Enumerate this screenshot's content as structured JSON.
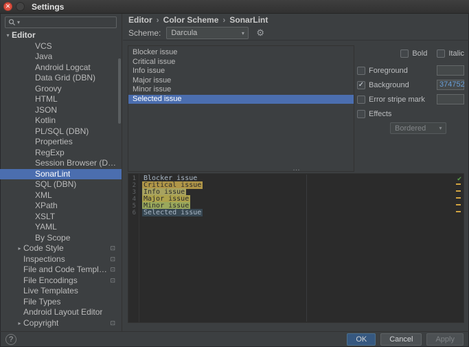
{
  "window": {
    "title": "Settings",
    "help_label": "?"
  },
  "icons": {
    "close": "✕",
    "check": "✓",
    "chevron_down": "▾",
    "tree_expanded": "▾",
    "tree_collapsed": "▸",
    "gear": "⚙",
    "status_ok": "✔",
    "project_badge": "⊡",
    "splitter_dots": "…"
  },
  "sidebar": {
    "search": {
      "placeholder": ""
    },
    "tree": [
      {
        "label": "Editor",
        "level": 0,
        "bold": true,
        "arrow": "expanded"
      },
      {
        "label": "VCS",
        "level": 2
      },
      {
        "label": "Java",
        "level": 2
      },
      {
        "label": "Android Logcat",
        "level": 2
      },
      {
        "label": "Data Grid (DBN)",
        "level": 2
      },
      {
        "label": "Groovy",
        "level": 2
      },
      {
        "label": "HTML",
        "level": 2
      },
      {
        "label": "JSON",
        "level": 2
      },
      {
        "label": "Kotlin",
        "level": 2
      },
      {
        "label": "PL/SQL (DBN)",
        "level": 2
      },
      {
        "label": "Properties",
        "level": 2
      },
      {
        "label": "RegExp",
        "level": 2
      },
      {
        "label": "Session Browser (DBN)",
        "level": 2
      },
      {
        "label": "SonarLint",
        "level": 2,
        "selected": true
      },
      {
        "label": "SQL (DBN)",
        "level": 2
      },
      {
        "label": "XML",
        "level": 2
      },
      {
        "label": "XPath",
        "level": 2
      },
      {
        "label": "XSLT",
        "level": 2
      },
      {
        "label": "YAML",
        "level": 2
      },
      {
        "label": "By Scope",
        "level": 2
      },
      {
        "label": "Code Style",
        "level": 1,
        "arrow": "collapsed",
        "badge": true
      },
      {
        "label": "Inspections",
        "level": 1,
        "badge": true
      },
      {
        "label": "File and Code Templates",
        "level": 1,
        "badge": true
      },
      {
        "label": "File Encodings",
        "level": 1,
        "badge": true
      },
      {
        "label": "Live Templates",
        "level": 1
      },
      {
        "label": "File Types",
        "level": 1
      },
      {
        "label": "Android Layout Editor",
        "level": 1
      },
      {
        "label": "Copyright",
        "level": 1,
        "arrow": "collapsed",
        "badge": true
      }
    ]
  },
  "breadcrumb": {
    "segments": [
      "Editor",
      "Color Scheme",
      "SonarLint"
    ],
    "separator": "›"
  },
  "scheme": {
    "label": "Scheme:",
    "value": "Darcula"
  },
  "issue_list": [
    {
      "label": "Blocker issue"
    },
    {
      "label": "Critical issue"
    },
    {
      "label": "Info issue"
    },
    {
      "label": "Major issue"
    },
    {
      "label": "Minor issue"
    },
    {
      "label": "Selected issue",
      "selected": true
    }
  ],
  "attributes": {
    "bold_label": "Bold",
    "bold_checked": false,
    "italic_label": "Italic",
    "italic_checked": false,
    "rows": [
      {
        "label": "Foreground",
        "checked": false,
        "value": ""
      },
      {
        "label": "Background",
        "checked": true,
        "value": "374752"
      },
      {
        "label": "Error stripe mark",
        "checked": false,
        "value": ""
      },
      {
        "label": "Effects",
        "checked": false
      }
    ],
    "effects_style": {
      "value": "Bordered"
    }
  },
  "preview": {
    "lines": [
      {
        "num": "1",
        "text": "Blocker issue",
        "fg": "#a9b7c6",
        "bg": ""
      },
      {
        "num": "2",
        "text": "Critical issue",
        "fg": "#2b2b2b",
        "bg": "#b09648"
      },
      {
        "num": "3",
        "text": "Info issue",
        "fg": "#2b2b2b",
        "bg": "#a8a35f"
      },
      {
        "num": "4",
        "text": "Major issue",
        "fg": "#2b2b2b",
        "bg": "#ada24c"
      },
      {
        "num": "5",
        "text": "Minor issue",
        "fg": "#2b2b2b",
        "bg": "#9aa85c"
      },
      {
        "num": "6",
        "text": "Selected issue",
        "fg": "#a9b7c6",
        "bg": "#374752"
      }
    ],
    "stripe_marks": [
      "warning",
      "warning",
      "warning",
      "warning",
      "warning"
    ]
  },
  "footer": {
    "ok_label": "OK",
    "cancel_label": "Cancel",
    "apply_label": "Apply"
  },
  "colors": {
    "selection": "#4b6eaf",
    "editor_background": "#2b2b2b",
    "background_value": "#374752",
    "value_text": "#6a9fd8",
    "ok_button": "#365880",
    "stripe_warning": "#d2a440",
    "status_ok": "#5ba54a"
  }
}
